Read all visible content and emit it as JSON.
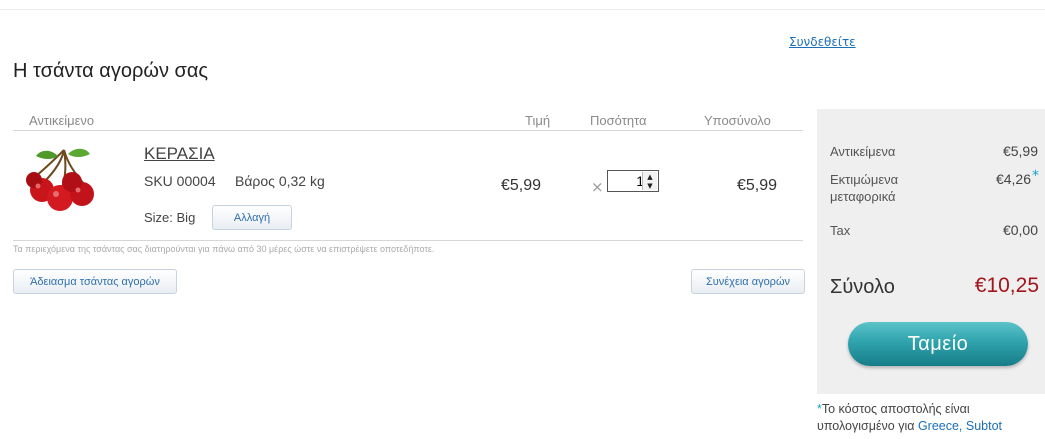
{
  "header": {
    "signin_label": "Συνδεθείτε"
  },
  "page": {
    "title": "Η τσάντα αγορών σας"
  },
  "columns": {
    "item": "Αντικείμενο",
    "price": "Τιμή",
    "quantity": "Ποσότητα",
    "subtotal": "Υποσύνολο"
  },
  "item": {
    "name": "ΚΕΡΑΣΙΑ",
    "sku": "SKU 00004",
    "weight": "Βάρος 0,32 kg",
    "size": "Size: Big",
    "change_label": "Αλλαγή",
    "price": "€5,99",
    "times": "×",
    "quantity": "1",
    "subtotal": "€5,99"
  },
  "notice": "Τα περιεχόμενα της τσάντας σας διατηρούνται για πάνω από 30 μέρες ώστε να επιστρέψετε οποτεδήποτε.",
  "actions": {
    "empty_cart": "Άδειασμα τσάντας αγορών",
    "continue_shopping": "Συνέχεια αγορών"
  },
  "summary": {
    "items_label": "Αντικείμενα",
    "items_value": "€5,99",
    "shipping_label_line1": "Εκτιμώμενα",
    "shipping_label_line2": "μεταφορικά",
    "shipping_value": "€4,26",
    "shipping_star": "*",
    "tax_label": "Tax",
    "tax_value": "€0,00",
    "total_label": "Σύνολο",
    "total_value": "€10,25",
    "checkout_label": "Ταμείο"
  },
  "footnote": {
    "star": "*",
    "line1": "Το κόστος αποστολής είναι",
    "line2_prefix": "υπολογισμένο για ",
    "line2_link": "Greece, Subtot"
  },
  "colors": {
    "accent": "#1b6fb8",
    "total": "#a3151b",
    "checkout": "#2fa3ad",
    "sidebar": "#efefef"
  }
}
